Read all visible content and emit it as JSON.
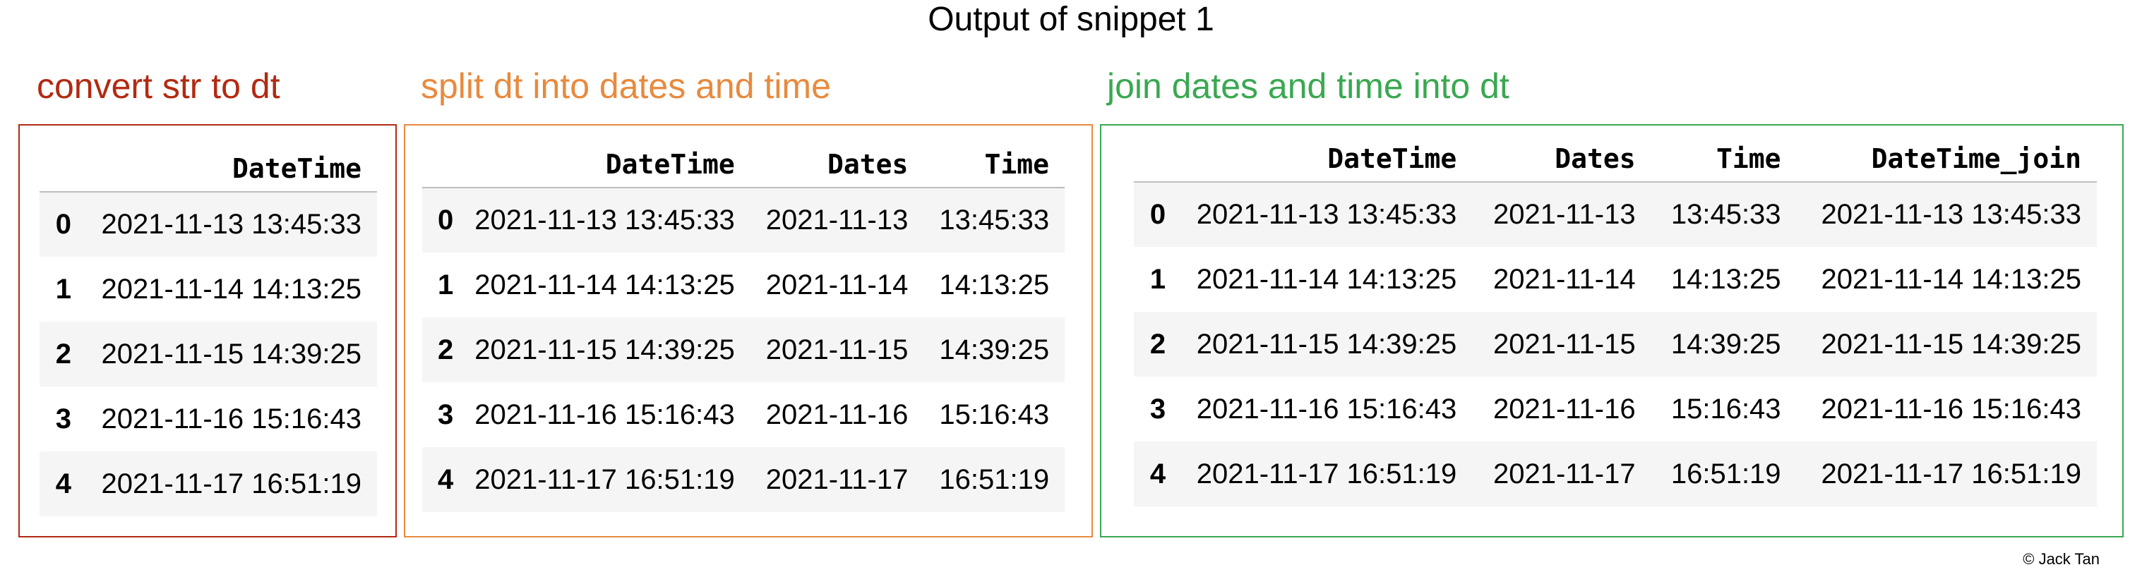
{
  "title": "Output of snippet 1",
  "colors": {
    "red": "#b22a12",
    "orange": "#e88a3e",
    "green": "#3aa851"
  },
  "panels": [
    {
      "heading": "convert str to dt",
      "columns": [
        "DateTime"
      ],
      "rows": [
        {
          "idx": "0",
          "cells": [
            "2021-11-13 13:45:33"
          ]
        },
        {
          "idx": "1",
          "cells": [
            "2021-11-14 14:13:25"
          ]
        },
        {
          "idx": "2",
          "cells": [
            "2021-11-15 14:39:25"
          ]
        },
        {
          "idx": "3",
          "cells": [
            "2021-11-16 15:16:43"
          ]
        },
        {
          "idx": "4",
          "cells": [
            "2021-11-17 16:51:19"
          ]
        }
      ]
    },
    {
      "heading": "split dt into dates and time",
      "columns": [
        "DateTime",
        "Dates",
        "Time"
      ],
      "rows": [
        {
          "idx": "0",
          "cells": [
            "2021-11-13 13:45:33",
            "2021-11-13",
            "13:45:33"
          ]
        },
        {
          "idx": "1",
          "cells": [
            "2021-11-14 14:13:25",
            "2021-11-14",
            "14:13:25"
          ]
        },
        {
          "idx": "2",
          "cells": [
            "2021-11-15 14:39:25",
            "2021-11-15",
            "14:39:25"
          ]
        },
        {
          "idx": "3",
          "cells": [
            "2021-11-16 15:16:43",
            "2021-11-16",
            "15:16:43"
          ]
        },
        {
          "idx": "4",
          "cells": [
            "2021-11-17 16:51:19",
            "2021-11-17",
            "16:51:19"
          ]
        }
      ]
    },
    {
      "heading": "join dates and time into dt",
      "columns": [
        "DateTime",
        "Dates",
        "Time",
        "DateTime_join"
      ],
      "rows": [
        {
          "idx": "0",
          "cells": [
            "2021-11-13 13:45:33",
            "2021-11-13",
            "13:45:33",
            "2021-11-13 13:45:33"
          ]
        },
        {
          "idx": "1",
          "cells": [
            "2021-11-14 14:13:25",
            "2021-11-14",
            "14:13:25",
            "2021-11-14 14:13:25"
          ]
        },
        {
          "idx": "2",
          "cells": [
            "2021-11-15 14:39:25",
            "2021-11-15",
            "14:39:25",
            "2021-11-15 14:39:25"
          ]
        },
        {
          "idx": "3",
          "cells": [
            "2021-11-16 15:16:43",
            "2021-11-16",
            "15:16:43",
            "2021-11-16 15:16:43"
          ]
        },
        {
          "idx": "4",
          "cells": [
            "2021-11-17 16:51:19",
            "2021-11-17",
            "16:51:19",
            "2021-11-17 16:51:19"
          ]
        }
      ]
    }
  ],
  "copyright": "© Jack Tan"
}
